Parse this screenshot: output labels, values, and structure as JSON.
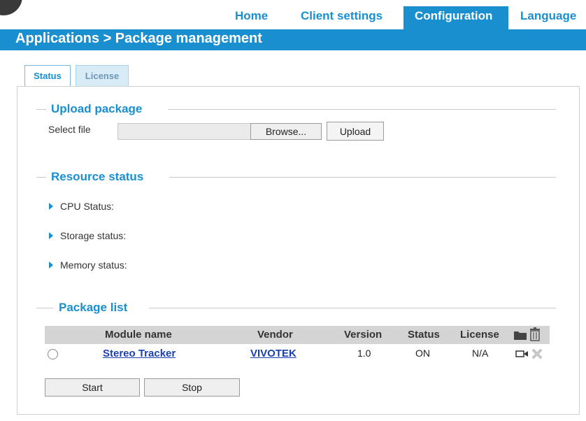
{
  "nav": {
    "home": "Home",
    "client_settings": "Client settings",
    "configuration": "Configuration",
    "language": "Language"
  },
  "breadcrumb": "Applications  > Package management",
  "tabs": [
    {
      "label": "Status",
      "active": true
    },
    {
      "label": "License",
      "active": false
    }
  ],
  "upload": {
    "title": "Upload package",
    "select_file_label": "Select file",
    "browse_label": "Browse...",
    "upload_label": "Upload"
  },
  "resource": {
    "title": "Resource status",
    "items": [
      "CPU Status:",
      "Storage status:",
      "Memory status:"
    ]
  },
  "package_list": {
    "title": "Package list",
    "columns": [
      "Module name",
      "Vendor",
      "Version",
      "Status",
      "License"
    ],
    "rows": [
      {
        "module_name": "Stereo Tracker",
        "vendor": "VIVOTEK",
        "version": "1.0",
        "status": "ON",
        "license": "N/A"
      }
    ],
    "header_icons": [
      "folder-icon",
      "trash-icon"
    ],
    "row_icons": [
      "camera-icon",
      "delete-icon"
    ],
    "start_label": "Start",
    "stop_label": "Stop"
  },
  "colors": {
    "accent": "#1a8fd0",
    "table_header": "#d4d4d4",
    "link": "#1a3fb0"
  }
}
